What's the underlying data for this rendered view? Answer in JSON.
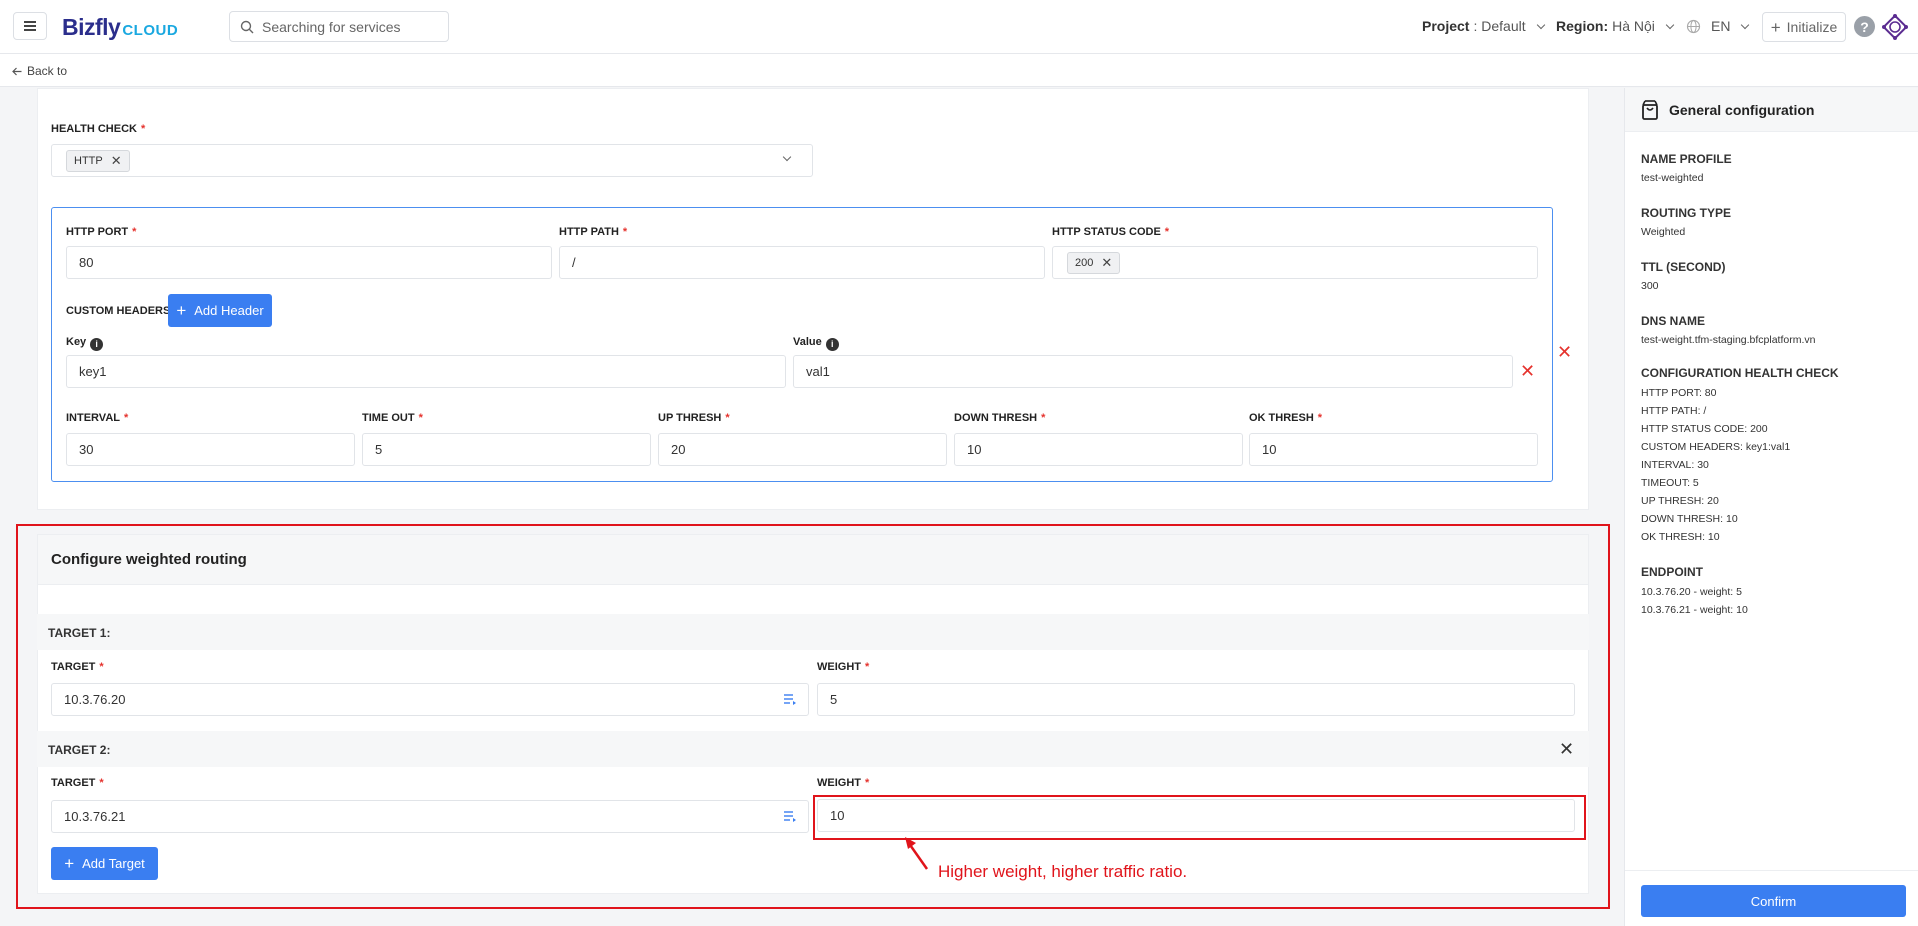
{
  "topbar": {
    "logo_main": "Bizfly",
    "logo_sub": "CLOUD",
    "search_placeholder": "Searching for services",
    "project_label": "Project",
    "project_value": ": Default",
    "region_label": "Region:",
    "region_value": "Hà Nội",
    "language": "EN",
    "initialize_label": "Initialize",
    "help_symbol": "?"
  },
  "nav": {
    "back_label": "Back to"
  },
  "health_check": {
    "label": "HEALTH CHECK",
    "selected_tag": "HTTP",
    "http_port_label": "HTTP PORT",
    "http_port_value": "80",
    "http_path_label": "HTTP PATH",
    "http_path_value": "/",
    "http_status_code_label": "HTTP STATUS CODE",
    "http_status_code_tag": "200",
    "custom_headers_label": "CUSTOM HEADERS",
    "add_header_label": "Add Header",
    "key_label": "Key",
    "key_value": "key1",
    "value_label": "Value",
    "value_value": "val1",
    "interval_label": "INTERVAL",
    "interval_value": "30",
    "timeout_label": "TIME OUT",
    "timeout_value": "5",
    "up_thresh_label": "UP THRESH",
    "up_thresh_value": "20",
    "down_thresh_label": "DOWN THRESH",
    "down_thresh_value": "10",
    "ok_thresh_label": "OK THRESH",
    "ok_thresh_value": "10"
  },
  "weighted_routing": {
    "title": "Configure weighted routing",
    "targets": [
      {
        "heading": "TARGET 1:",
        "target_label": "TARGET",
        "target_value": "10.3.76.20",
        "weight_label": "WEIGHT",
        "weight_value": "5"
      },
      {
        "heading": "TARGET 2:",
        "target_label": "TARGET",
        "target_value": "10.3.76.21",
        "weight_label": "WEIGHT",
        "weight_value": "10"
      }
    ],
    "add_target_label": "Add Target",
    "annotation": "Higher weight, higher traffic ratio."
  },
  "sidebar": {
    "title": "General configuration",
    "name_profile_label": "NAME PROFILE",
    "name_profile_value": "test-weighted",
    "routing_type_label": "ROUTING TYPE",
    "routing_type_value": "Weighted",
    "ttl_label": "TTL (SECOND)",
    "ttl_value": "300",
    "dns_name_label": "DNS NAME",
    "dns_name_value": "test-weight.tfm-staging.bfcplatform.vn",
    "health_check_label": "CONFIGURATION HEALTH CHECK",
    "health_check_lines": [
      "HTTP PORT: 80",
      "HTTP PATH: /",
      "HTTP STATUS CODE: 200",
      "CUSTOM HEADERS: key1:val1",
      "INTERVAL: 30",
      "TIMEOUT: 5",
      "UP THRESH: 20",
      "DOWN THRESH: 10",
      "OK THRESH: 10"
    ],
    "endpoint_label": "ENDPOINT",
    "endpoint_lines": [
      "10.3.76.20 - weight: 5",
      "10.3.76.21 - weight: 10"
    ],
    "confirm_label": "Confirm"
  },
  "colors": {
    "primary": "#3a7ef1",
    "required": "#e5322d",
    "annotation": "#e0141b",
    "logo_dark": "#2b2e8c",
    "logo_light": "#1aa8e0"
  }
}
